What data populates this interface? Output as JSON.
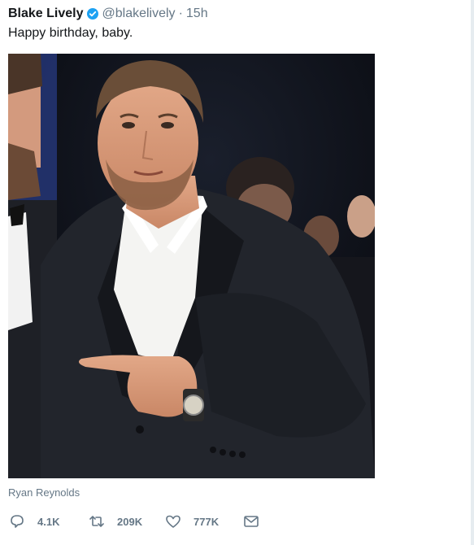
{
  "tweet": {
    "author_name": "Blake Lively",
    "handle": "@blakelively",
    "separator": "·",
    "time": "15h",
    "text": "Happy birthday, baby.",
    "photo_caption": "Ryan Reynolds",
    "accent_color": "#1da1f2"
  },
  "actions": {
    "reply_count": "4.1K",
    "retweet_count": "209K",
    "like_count": "777K"
  },
  "icons": {
    "verified": "verified-badge-icon",
    "reply": "reply-icon",
    "retweet": "retweet-icon",
    "like": "heart-icon",
    "message": "envelope-icon"
  }
}
